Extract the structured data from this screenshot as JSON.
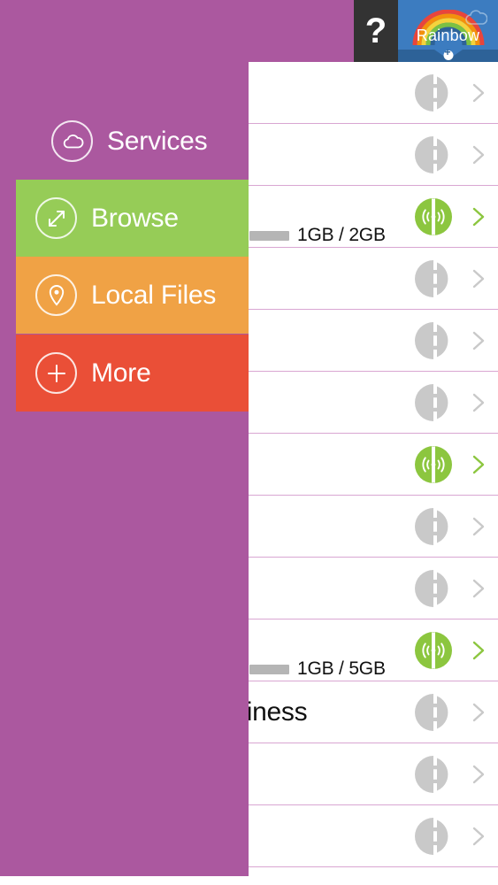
{
  "topbar": {
    "help_label": "?",
    "brand_name": "Rainbow",
    "help_icon": "question-mark-icon",
    "brand_icon": "rainbow-logo-icon",
    "colors": {
      "help_bg": "#333333",
      "brand_bg": "#3c7cc0",
      "brand_notch": "#2d6298"
    }
  },
  "sidebar": {
    "background_color": "#ab589f",
    "items": [
      {
        "label": "Services",
        "icon": "cloud-icon",
        "bg": "transparent",
        "active": false
      },
      {
        "label": "Browse",
        "icon": "expand-icon",
        "bg": "#96cc57",
        "active": true
      },
      {
        "label": "Local Files",
        "icon": "location-pin-icon",
        "bg": "#f0a245",
        "active": true
      },
      {
        "label": "More",
        "icon": "plus-icon",
        "bg": "#ea4f37",
        "active": true
      }
    ]
  },
  "list": {
    "divider_color": "#d9a6d2",
    "status": {
      "connected_icon": "connected-broadcast-icon",
      "disconnected_icon": "disconnected-plug-icon",
      "connected_color": "#8cc63f",
      "disconnected_color": "#c9c9c9"
    },
    "chevron_icon": "chevron-right-icon",
    "rows": [
      {
        "name": "",
        "status": "disconnected",
        "meter": null
      },
      {
        "name": "",
        "status": "disconnected",
        "meter": null
      },
      {
        "name": "",
        "status": "connected",
        "meter": {
          "used": "1GB",
          "total": "2GB",
          "label": "1GB / 2GB",
          "percent": 50
        }
      },
      {
        "name": "",
        "status": "disconnected",
        "meter": null
      },
      {
        "name": "",
        "status": "disconnected",
        "meter": null
      },
      {
        "name": "",
        "status": "disconnected",
        "meter": null
      },
      {
        "name": "",
        "status": "connected",
        "meter": null
      },
      {
        "name": "",
        "status": "disconnected",
        "meter": null
      },
      {
        "name": "",
        "status": "disconnected",
        "meter": null
      },
      {
        "name": "",
        "status": "connected",
        "meter": {
          "used": "1GB",
          "total": "5GB",
          "label": "1GB / 5GB",
          "percent": 20
        }
      },
      {
        "name": "Business",
        "status": "disconnected",
        "meter": null
      },
      {
        "name": "",
        "status": "disconnected",
        "meter": null
      },
      {
        "name": "",
        "status": "disconnected",
        "meter": null
      }
    ]
  }
}
